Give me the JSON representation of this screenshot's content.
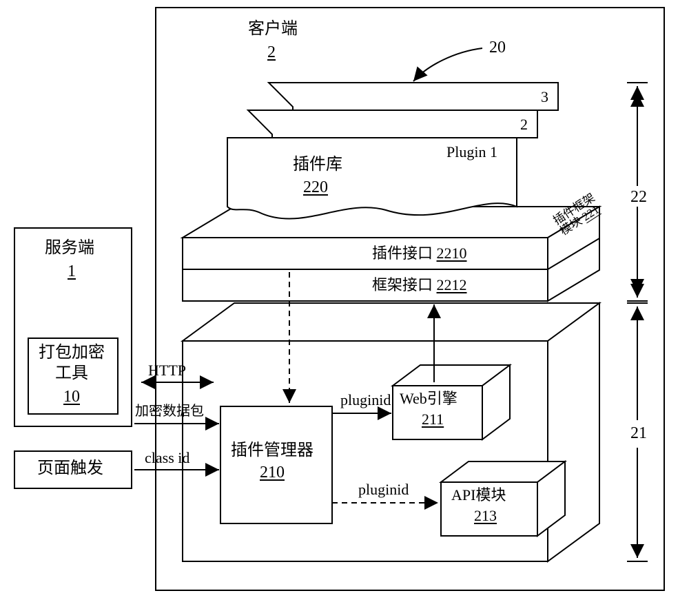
{
  "client": {
    "title": "客户端",
    "num": "2"
  },
  "server": {
    "title": "服务端",
    "num": "1"
  },
  "tool": {
    "title": "打包加密",
    "sub": "工具",
    "num": "10"
  },
  "trigger": "页面触发",
  "pluginlib": {
    "title": "插件库",
    "num": "220"
  },
  "plugin1": "Plugin 1",
  "plugin2": "2",
  "plugin3": "3",
  "plugin_if": {
    "title": "插件接口",
    "num": "2210"
  },
  "frame_if": {
    "title": "框架接口",
    "num": "2212"
  },
  "frame_mod": {
    "title": "插件框架",
    "title2": "模块",
    "num": "221"
  },
  "mgr": {
    "title": "插件管理器",
    "num": "210"
  },
  "web": {
    "title": "Web引擎",
    "num": "211"
  },
  "api": {
    "title": "API模块",
    "num": "213"
  },
  "conn": {
    "http": "HTTP",
    "enc": "加密数据包",
    "class": "class id",
    "pid1": "pluginid",
    "pid2": "pluginid"
  },
  "bracket20": "20",
  "bracket22": "22",
  "bracket21": "21"
}
